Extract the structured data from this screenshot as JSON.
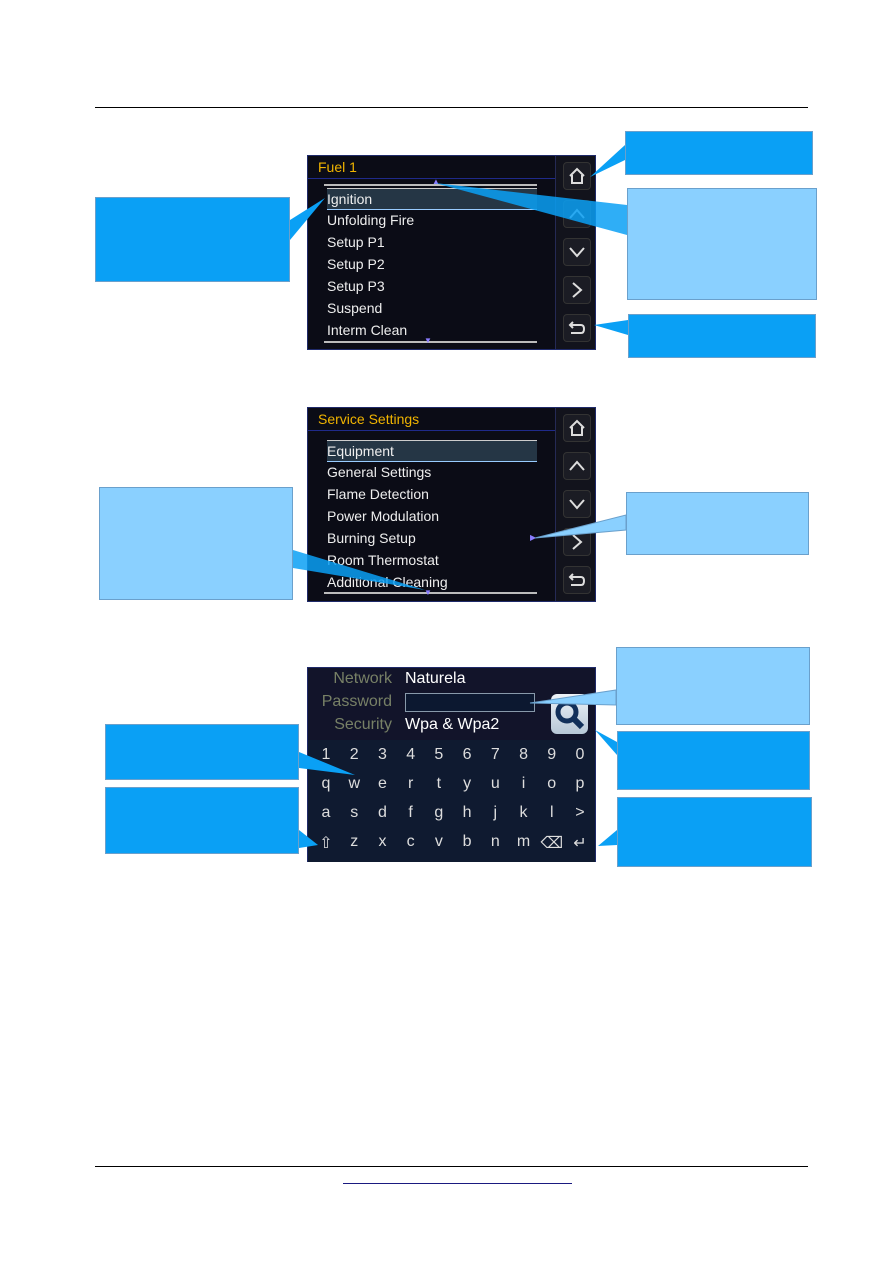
{
  "screen1": {
    "title": "Fuel 1",
    "items": [
      "Ignition",
      "Unfolding Fire",
      "Setup P1",
      "Setup P2",
      "Setup P3",
      "Suspend",
      "Interm Clean"
    ],
    "selected": "Ignition"
  },
  "screen2": {
    "title": "Service Settings",
    "items": [
      "Equipment",
      "General Settings",
      "Flame Detection",
      "Power Modulation",
      "Burning Setup",
      "Room Thermostat",
      "Additional Cleaning"
    ],
    "selected": "Equipment"
  },
  "screen3": {
    "network_label": "Network",
    "network_value": "Naturela",
    "password_label": "Password",
    "password_value": "",
    "security_label": "Security",
    "security_value": "Wpa & Wpa2",
    "keys": [
      [
        "1",
        "2",
        "3",
        "4",
        "5",
        "6",
        "7",
        "8",
        "9",
        "0"
      ],
      [
        "q",
        "w",
        "e",
        "r",
        "t",
        "y",
        "u",
        "i",
        "o",
        "p"
      ],
      [
        "a",
        "s",
        "d",
        "f",
        "g",
        "h",
        "j",
        "k",
        "l",
        ">"
      ],
      [
        "⇧",
        "z",
        "x",
        "c",
        "v",
        "b",
        "n",
        "m",
        "⌫",
        "↵"
      ]
    ]
  },
  "side_buttons": [
    "home-icon",
    "chevron-up-icon",
    "chevron-down-icon",
    "chevron-right-icon",
    "return-icon"
  ],
  "colors": {
    "callout_dark": "#0aa0f5",
    "callout_light": "#8ad0ff",
    "title": "#f0b400"
  }
}
